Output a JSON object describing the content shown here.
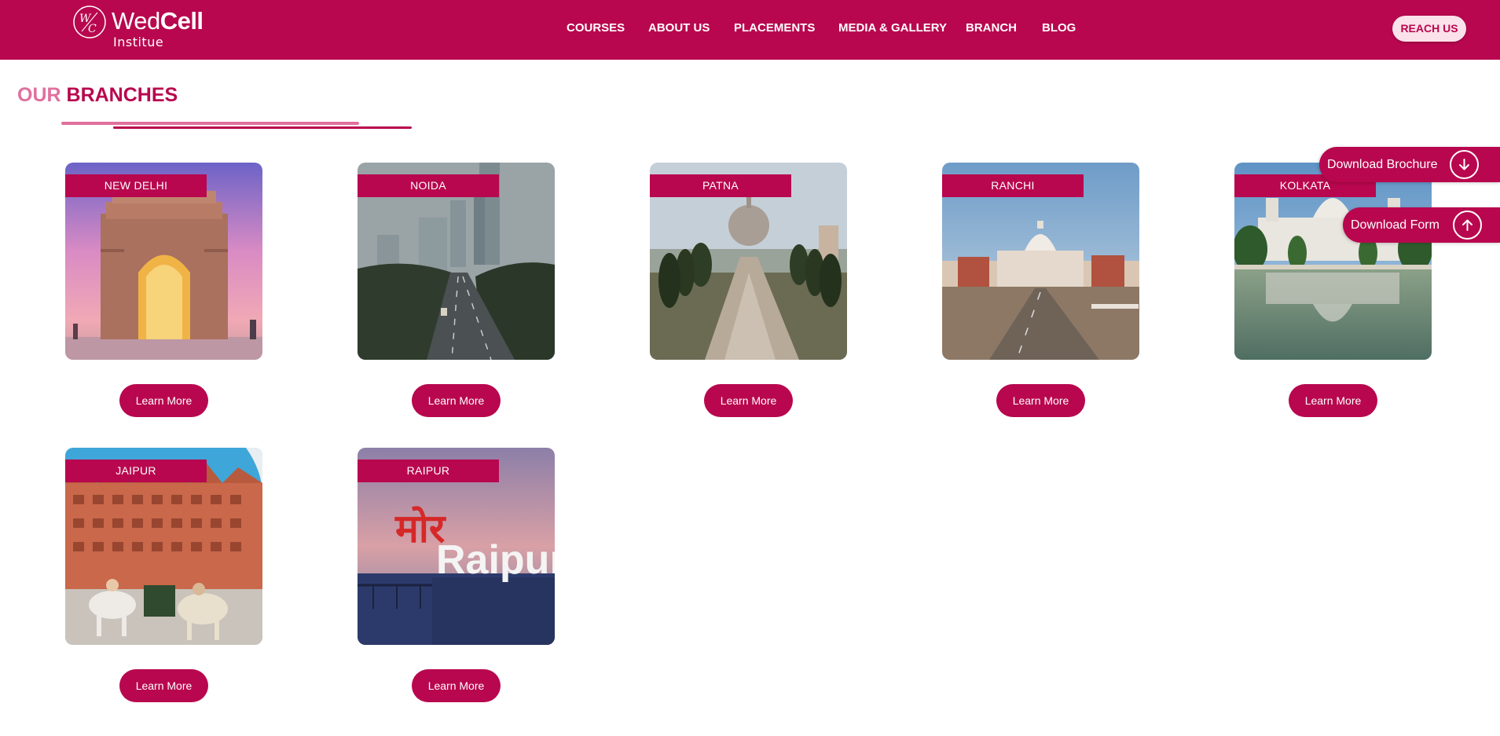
{
  "brand": {
    "name_light": "Wed",
    "name_bold": "Cell",
    "subtitle": "Institue",
    "logo_mark": "WC"
  },
  "nav": {
    "items": [
      "COURSES",
      "ABOUT US",
      "PLACEMENTS",
      "MEDIA & GALLERY",
      "BRANCH",
      "BLOG"
    ],
    "reach_label": "REACH US"
  },
  "section": {
    "title_part1": "OUR",
    "title_part2": "BRANCHES"
  },
  "branches": [
    {
      "city": "NEW DELHI",
      "button": "Learn More",
      "image": "india-gate-photo"
    },
    {
      "city": "NOIDA",
      "button": "Learn More",
      "image": "noida-expressway-photo"
    },
    {
      "city": "PATNA",
      "button": "Learn More",
      "image": "patna-buddha-smriti-park-photo"
    },
    {
      "city": "RANCHI",
      "button": "Learn More",
      "image": "ranchi-assembly-photo"
    },
    {
      "city": "KOLKATA",
      "button": "Learn More",
      "image": "victoria-memorial-photo"
    },
    {
      "city": "JAIPUR",
      "button": "Learn More",
      "image": "hawa-mahal-photo"
    },
    {
      "city": "RAIPUR",
      "button": "Learn More",
      "image": "raipur-sign-photo"
    }
  ],
  "floating": {
    "brochure_label": "Download Brochure",
    "form_label": "Download Form"
  },
  "colors": {
    "primary": "#b8074e",
    "accent_light": "#e0709e",
    "reach_bg": "#fbe1ea"
  },
  "photo_text": {
    "raipur_devanagari": "मोर",
    "raipur_latin": "Raipur"
  }
}
